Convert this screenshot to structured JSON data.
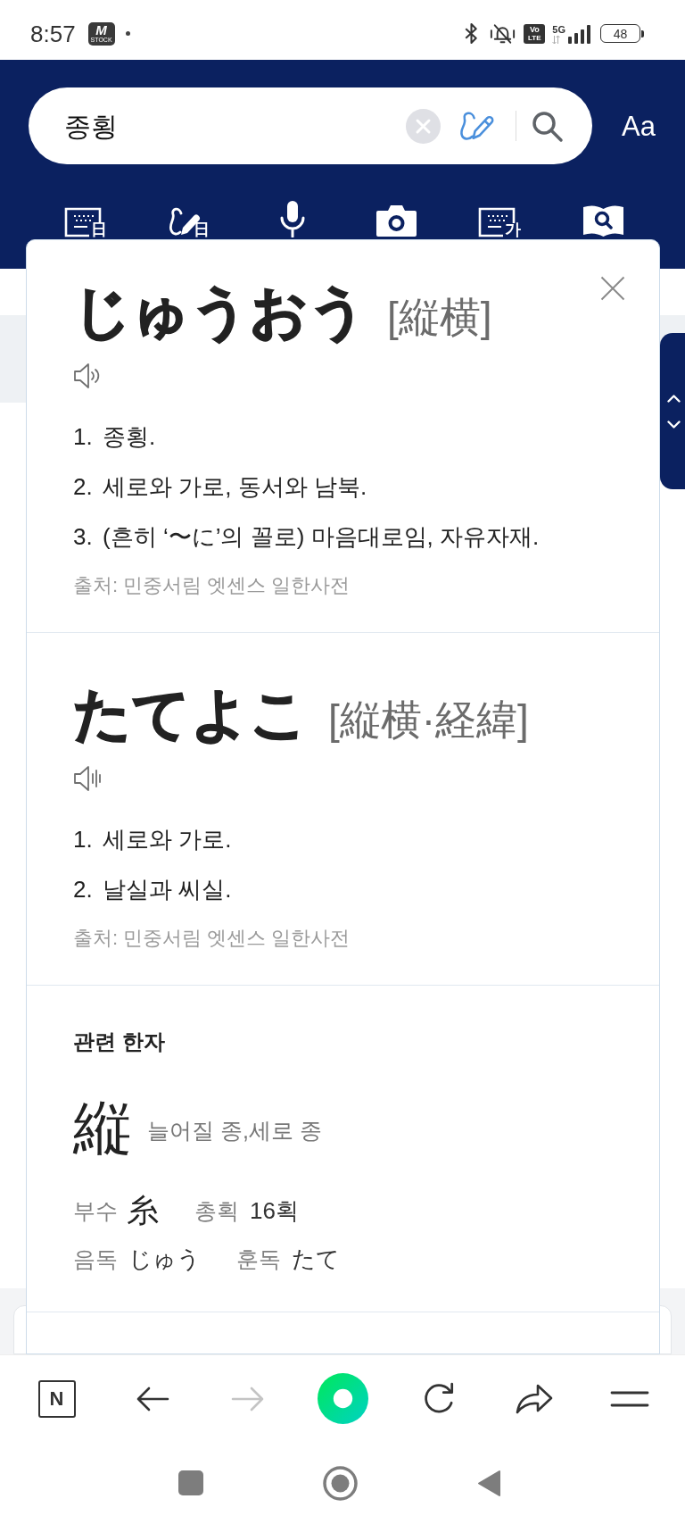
{
  "status_bar": {
    "time": "8:57",
    "notification": {
      "letter": "M",
      "caption": "STOCK"
    },
    "volte": [
      "Vo",
      "LTE"
    ],
    "network": "5G",
    "battery": "48"
  },
  "header": {
    "search": {
      "value": "종횡"
    },
    "font_size_button": "Aa",
    "input_modes": [
      {
        "kind": "keyboard",
        "glyph": "日"
      },
      {
        "kind": "handwriting",
        "glyph": "日"
      },
      {
        "kind": "voice"
      },
      {
        "kind": "camera"
      },
      {
        "kind": "keyboard",
        "glyph": "가"
      },
      {
        "kind": "book-search"
      }
    ]
  },
  "entries": [
    {
      "kind": "waves",
      "headword": "じゅうおう",
      "hanja": "[縦横]",
      "definitions": [
        {
          "number": "1.",
          "text": "종횡."
        },
        {
          "number": "2.",
          "text": "세로와 가로, 동서와 남북."
        },
        {
          "number": "3.",
          "text": "(흔히 ‘〜に’의 꼴로) 마음대로임, 자유자재."
        }
      ],
      "source": "출처: 민중서림 엣센스 일한사전"
    },
    {
      "kind": "bars",
      "headword": "たてよこ",
      "hanja": "[縦横·経緯]",
      "definitions": [
        {
          "number": "1.",
          "text": "세로와 가로."
        },
        {
          "number": "2.",
          "text": "날실과 씨실."
        }
      ],
      "source": "출처: 민중서림 엣센스 일한사전"
    }
  ],
  "related_hanja": {
    "heading": "관련 한자",
    "character": "縦",
    "meaning": "늘어질 종,세로 종",
    "rows": [
      [
        {
          "label": "부수",
          "value": "糸",
          "kind": "hanja"
        },
        {
          "label": "총획",
          "value": "16획",
          "kind": "text"
        }
      ],
      [
        {
          "label": "음독",
          "value": "じゅう",
          "kind": "text"
        },
        {
          "label": "훈독",
          "value": "たて",
          "kind": "text"
        }
      ]
    ]
  },
  "toolbar": [
    {
      "kind": "home",
      "label": "N",
      "disabled": false
    },
    {
      "kind": "back",
      "disabled": false
    },
    {
      "kind": "forward",
      "disabled": true
    },
    {
      "kind": "main",
      "disabled": false
    },
    {
      "kind": "reload",
      "disabled": false
    },
    {
      "kind": "share",
      "disabled": false
    },
    {
      "kind": "menu",
      "disabled": false
    }
  ]
}
